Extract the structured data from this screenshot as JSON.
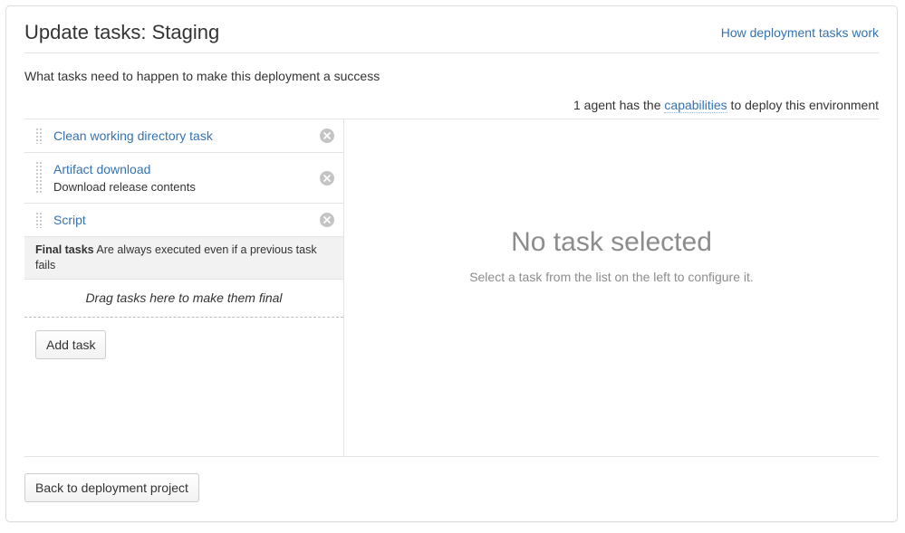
{
  "header": {
    "title": "Update tasks: Staging",
    "help_link": "How deployment tasks work"
  },
  "subtitle": "What tasks need to happen to make this deployment a success",
  "agent_notice": {
    "prefix": "1 agent has the ",
    "link": "capabilities",
    "suffix": " to deploy this environment"
  },
  "tasks": [
    {
      "name": "Clean working directory task",
      "description": "",
      "remove_label": "Remove task"
    },
    {
      "name": "Artifact download",
      "description": "Download release contents",
      "remove_label": "Remove task"
    },
    {
      "name": "Script",
      "description": "",
      "remove_label": "Remove task"
    }
  ],
  "final_tasks": {
    "heading": "Final tasks",
    "description": "Are always executed even if a previous task fails",
    "dropzone_text": "Drag tasks here to make them final"
  },
  "buttons": {
    "add_task": "Add task",
    "back": "Back to deployment project"
  },
  "empty_state": {
    "title": "No task selected",
    "subtitle": "Select a task from the list on the left to configure it."
  },
  "colors": {
    "link": "#3572b0",
    "text": "#333333",
    "muted": "#8c8c8c",
    "border": "#e4e4e4",
    "panel_header_bg": "#f2f2f2",
    "remove_icon_bg": "#c4c4c4"
  }
}
